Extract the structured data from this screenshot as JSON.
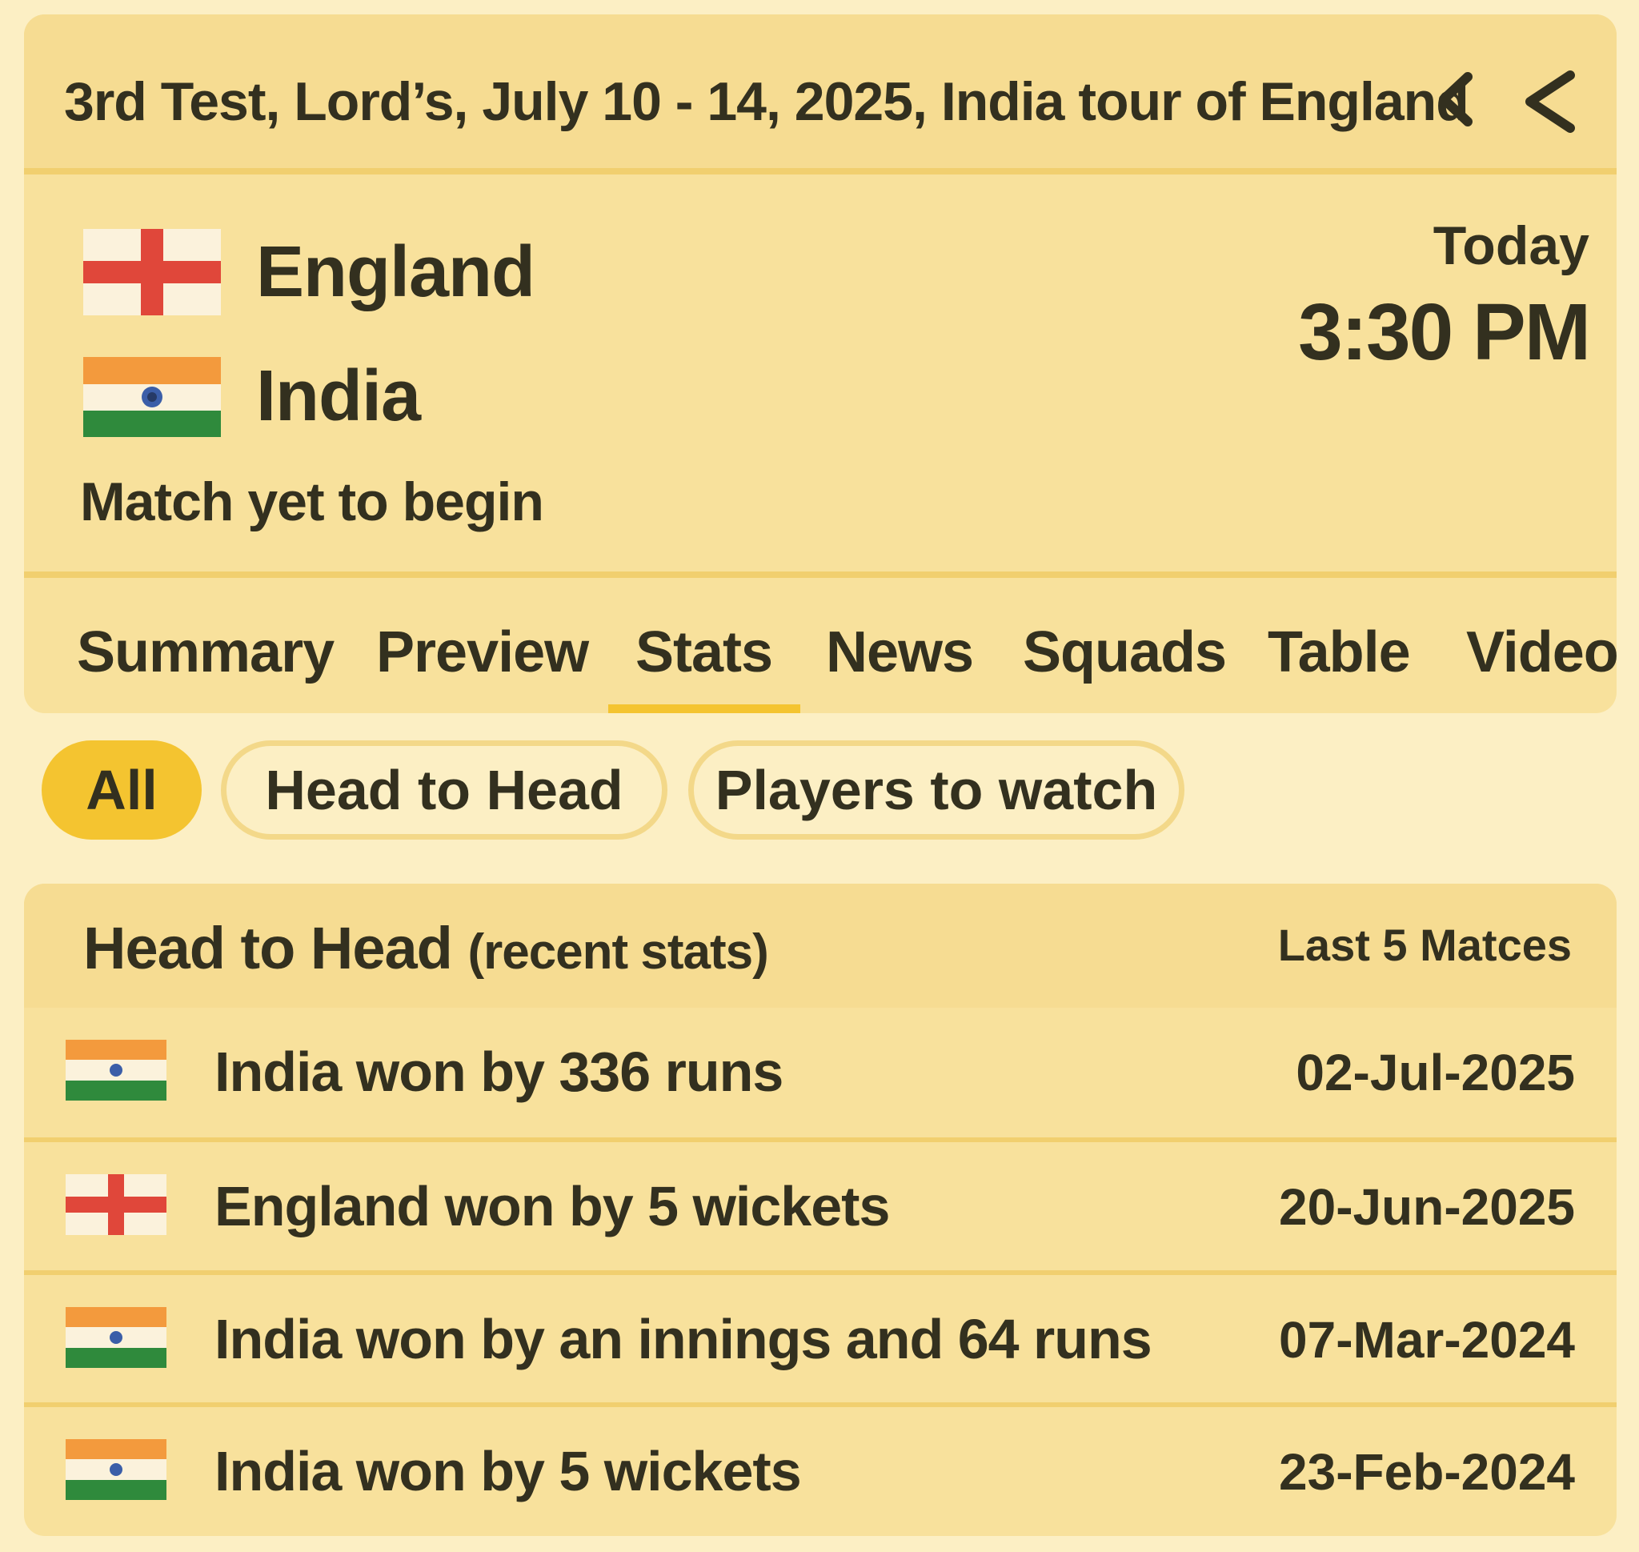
{
  "header": {
    "title": "3rd Test, Lord’s, July 10 - 14, 2025, India tour of England"
  },
  "match": {
    "team1": {
      "name": "England",
      "flag": "england-flag"
    },
    "team2": {
      "name": "India",
      "flag": "india-flag"
    },
    "day": "Today",
    "time": "3:30 PM",
    "status": "Match yet to begin"
  },
  "tabs": [
    "Summary",
    "Preview",
    "Stats",
    "News",
    "Squads",
    "Table",
    "Video"
  ],
  "active_tab": "Stats",
  "filters": {
    "all": "All",
    "head_to_head": "Head to Head",
    "players": "Players to watch"
  },
  "h2h": {
    "title": "Head to Head",
    "subtitle": "(recent stats)",
    "count_label": "Last 5 Matces",
    "rows": [
      {
        "flag": "india-flag",
        "result": "India won by 336 runs",
        "date": "02-Jul-2025"
      },
      {
        "flag": "england-flag",
        "result": "England won by 5 wickets",
        "date": "20-Jun-2025"
      },
      {
        "flag": "india-flag",
        "result": "India won by an innings and 64 runs",
        "date": "07-Mar-2024"
      },
      {
        "flag": "india-flag",
        "result": "India won by 5 wickets",
        "date": "23-Feb-2024"
      }
    ]
  },
  "colors": {
    "page_bg": "#fcefc4",
    "card_bg": "#f8e19c",
    "accent": "#f4c430",
    "england_red": "#e0473a",
    "india_saffron": "#f39a3d",
    "india_green": "#2f8a3c",
    "chakra_blue": "#3b5ea8"
  }
}
